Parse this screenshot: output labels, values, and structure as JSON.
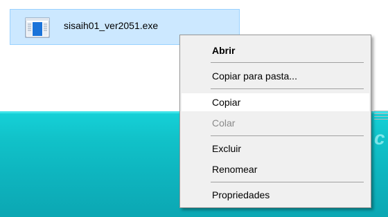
{
  "file": {
    "name": "sisaih01_ver2051.exe",
    "icon": "exe-application-icon",
    "selected": true
  },
  "context_menu": {
    "items": [
      {
        "label": "Abrir",
        "style": "bold",
        "enabled": true
      },
      {
        "label": "Copiar para pasta...",
        "enabled": true
      },
      {
        "label": "Copiar",
        "enabled": true,
        "hovered": true
      },
      {
        "label": "Colar",
        "enabled": false
      },
      {
        "label": "Excluir",
        "enabled": true
      },
      {
        "label": "Renomear",
        "enabled": true
      },
      {
        "label": "Propriedades",
        "enabled": true
      }
    ]
  },
  "colors": {
    "selection_fill": "#cce8ff",
    "selection_border": "#99d1ff",
    "menu_background": "#f0f0f0",
    "menu_hover": "#ffffff",
    "disabled_text": "#8a8a8a",
    "teal_background": "#11c2c9"
  }
}
